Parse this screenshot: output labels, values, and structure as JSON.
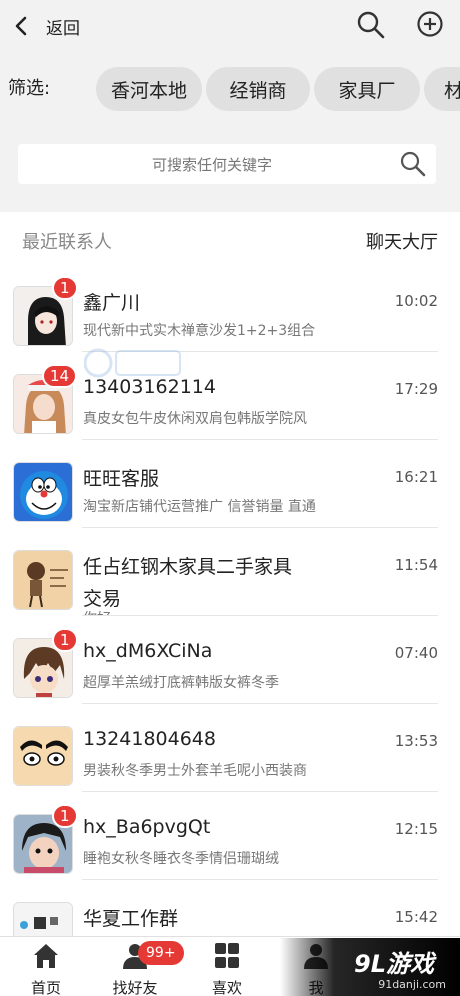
{
  "header": {
    "back_label": "返回"
  },
  "filter": {
    "label": "筛选:",
    "chips": [
      "香河本地",
      "经销商",
      "家具厂",
      "材"
    ]
  },
  "search": {
    "placeholder": "可搜索任何关键字"
  },
  "tabs": {
    "recent": "最近联系人",
    "chat_hall": "聊天大厅"
  },
  "contacts": [
    {
      "name": "鑫广川",
      "time": "10:02",
      "message": "现代新中式实木禅意沙发1+2+3组合",
      "badge": "1"
    },
    {
      "name": "13403162114",
      "time": "17:29",
      "message": "真皮女包牛皮休闲双肩包韩版学院风",
      "badge": "14"
    },
    {
      "name": "旺旺客服",
      "time": "16:21",
      "message": "淘宝新店铺代运营推广 信誉销量 直通",
      "badge": ""
    },
    {
      "name": "任占红钢木家具二手家具",
      "name2": "交易",
      "time": "11:54",
      "message": "你好",
      "badge": ""
    },
    {
      "name": "hx_dM6XCiNa",
      "time": "07:40",
      "message": "超厚羊羔绒打底裤韩版女裤冬季",
      "badge": "1"
    },
    {
      "name": "13241804648",
      "time": "13:53",
      "message": "男装秋冬季男士外套羊毛呢小西装商",
      "badge": ""
    },
    {
      "name": "hx_Ba6pvgQt",
      "time": "12:15",
      "message": "睡袍女秋冬睡衣冬季情侣珊瑚绒",
      "badge": "1"
    },
    {
      "name": "华夏工作群",
      "time": "15:42",
      "message": "",
      "badge": ""
    }
  ],
  "nav": {
    "items": [
      "首页",
      "找好友",
      "喜欢",
      "我"
    ],
    "friends_badge": "99+"
  },
  "watermark": {
    "logo": "9L游戏",
    "url": "91danji.com"
  },
  "colors": {
    "badge": "#e53935",
    "header_bg": "#f2f2f2",
    "chip_bg": "#e0e0e0"
  }
}
